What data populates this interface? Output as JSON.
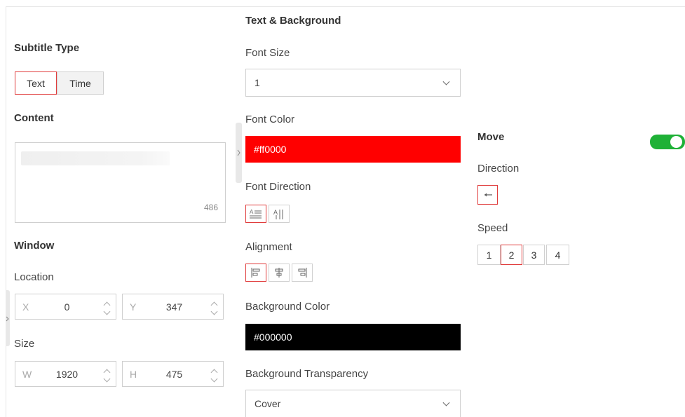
{
  "left": {
    "subtitle_type": {
      "heading": "Subtitle Type",
      "options": [
        "Text",
        "Time"
      ],
      "selected": "Text"
    },
    "content": {
      "heading": "Content",
      "char_count": "486"
    },
    "window": {
      "heading": "Window",
      "location_label": "Location",
      "x_prefix": "X",
      "x_value": "0",
      "y_prefix": "Y",
      "y_value": "347",
      "size_label": "Size",
      "w_prefix": "W",
      "w_value": "1920",
      "h_prefix": "H",
      "h_value": "475"
    }
  },
  "middle": {
    "heading": "Text & Background",
    "font_size": {
      "label": "Font Size",
      "value": "1"
    },
    "font_color": {
      "label": "Font Color",
      "value": "#ff0000",
      "color": "#ff0000"
    },
    "font_direction": {
      "label": "Font Direction",
      "options": [
        "horizontal-text-icon",
        "vertical-text-icon"
      ],
      "selected": "horizontal-text-icon"
    },
    "alignment": {
      "label": "Alignment",
      "options": [
        "align-left-icon",
        "align-center-icon",
        "align-right-icon"
      ],
      "selected": "align-left-icon"
    },
    "background_color": {
      "label": "Background Color",
      "value": "#000000",
      "color": "#000000"
    },
    "background_transparency": {
      "label": "Background Transparency",
      "value": "Cover"
    }
  },
  "right": {
    "move": {
      "label": "Move",
      "enabled": true,
      "toggle_color": "#1fb137"
    },
    "direction": {
      "label": "Direction",
      "selected": "left-arrow-icon"
    },
    "speed": {
      "label": "Speed",
      "options": [
        "1",
        "2",
        "3",
        "4"
      ],
      "selected": "2"
    }
  },
  "colors": {
    "accent": "#e03c3c",
    "border": "#d0d0d0"
  }
}
